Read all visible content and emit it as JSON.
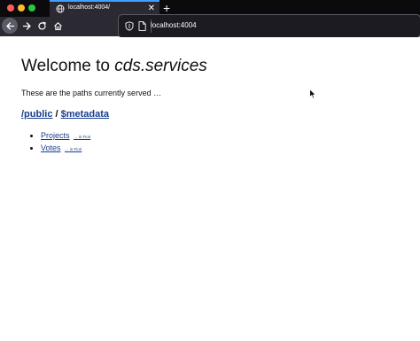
{
  "browser": {
    "tab": {
      "title": "localhost:4004/",
      "close_icon": "close-icon",
      "favicon": "globe-icon"
    },
    "new_tab_icon": "plus-icon",
    "nav": {
      "back_icon": "arrow-left-icon",
      "forward_icon": "arrow-right-icon",
      "reload_icon": "reload-icon",
      "home_icon": "home-icon"
    },
    "urlbar": {
      "value": "localhost:4004",
      "shield_icon": "shield-icon",
      "page_icon": "page-icon"
    },
    "colors": {
      "tab_accent": "#40a0ff",
      "toolbar_bg": "#2b2a33",
      "titlebar_bg": "#0b0b0d"
    }
  },
  "page": {
    "title_prefix": "Welcome to ",
    "title_emphasis": "cds.services",
    "intro": "These are the paths currently served …",
    "paths": {
      "public_link": "/public",
      "separator": " / ",
      "metadata_link": "$metadata"
    },
    "entities": [
      {
        "name": "Projects",
        "fiori": "… in Fiori"
      },
      {
        "name": "Votes",
        "fiori": "… in Fiori"
      }
    ],
    "link_color": "#1a3d8f"
  }
}
